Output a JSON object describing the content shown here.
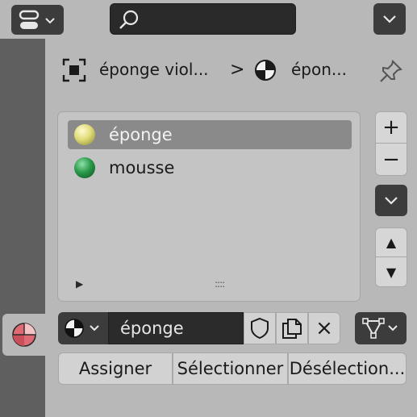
{
  "colors": {
    "background": "#b8b8b8",
    "tab_strip": "#5f5f5f",
    "dark_button": "#3c3c3c",
    "selected_row": "#8a8a8a",
    "material_active_tab": "#e06a73"
  },
  "header": {
    "editor_type_icon": "editor-type-icon",
    "search": {
      "placeholder": "",
      "value": ""
    },
    "dropdown_icon": "chevron-down-icon"
  },
  "breadcrumb": {
    "object_label": "éponge viol...",
    "separator": ">",
    "material_label": "épon...",
    "pin_icon": "pin-icon"
  },
  "material_slots": {
    "items": [
      {
        "label": "éponge",
        "color": "#e0dc7a",
        "selected": true
      },
      {
        "label": "mousse",
        "color": "#2a9a4a",
        "selected": false
      }
    ],
    "expand_glyph": "▶",
    "grip_glyph": "::::"
  },
  "side_buttons": {
    "add": "+",
    "remove": "−",
    "specials": "chevron-down-icon",
    "move_up": "▲",
    "move_down": "▼"
  },
  "material_field": {
    "value": "éponge",
    "fake_user_icon": "shield-icon",
    "duplicate_icon": "duplicate-icon",
    "unlink_label": "×"
  },
  "actions": {
    "assign": "Assigner",
    "select": "Sélectionner",
    "deselect": "Désélection..."
  }
}
